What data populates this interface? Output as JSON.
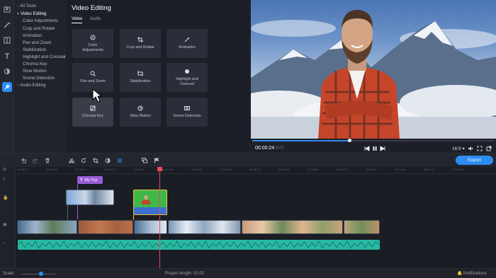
{
  "rail": {
    "icons": [
      "import-icon",
      "magic-wand-icon",
      "transitions-icon",
      "titles-icon",
      "filters-icon",
      "tools-icon"
    ]
  },
  "tree": {
    "items": [
      {
        "label": "All Tools",
        "top": true
      },
      {
        "label": "Video Editing",
        "top": true,
        "expanded": true
      },
      {
        "label": "Color Adjustments"
      },
      {
        "label": "Crop and Rotate"
      },
      {
        "label": "Animation"
      },
      {
        "label": "Pan and Zoom"
      },
      {
        "label": "Stabilization"
      },
      {
        "label": "Highlight and Conceal"
      },
      {
        "label": "Chroma Key"
      },
      {
        "label": "Slow Motion"
      },
      {
        "label": "Scene Detection"
      },
      {
        "label": "Audio Editing",
        "top": true
      }
    ]
  },
  "panel": {
    "title": "Video Editing",
    "tabs": [
      "Video",
      "Audio"
    ],
    "cards": [
      {
        "label": "Color\nAdjustments",
        "icon": "color-wheel-icon"
      },
      {
        "label": "Crop and Rotate",
        "icon": "crop-icon"
      },
      {
        "label": "Animation",
        "icon": "animation-icon"
      },
      {
        "label": "Pan and Zoom",
        "icon": "zoom-icon"
      },
      {
        "label": "Stabilization",
        "icon": "stabilization-icon"
      },
      {
        "label": "Highlight and\nConceal",
        "icon": "highlight-icon"
      },
      {
        "label": "Chroma Key",
        "icon": "chroma-key-icon"
      },
      {
        "label": "Slow Motion",
        "icon": "slow-motion-icon"
      },
      {
        "label": "Scene Detection",
        "icon": "scene-detection-icon"
      }
    ]
  },
  "player": {
    "time_current": "00:00:24",
    "time_frac": "870",
    "progress": 0.4,
    "ratio": "16:9 ▾"
  },
  "toolbar": {
    "export_label": "Export"
  },
  "timeline": {
    "ticks": [
      "00:00:00",
      "00:00:05",
      "00:00:10",
      "00:00:15",
      "00:00:20",
      "00:00:25",
      "00:00:30",
      "00:00:35",
      "00:00:40",
      "00:00:45",
      "00:00:50",
      "00:00:55",
      "00:01:00",
      "00:01:05",
      "00:01:10",
      "00:01:15"
    ],
    "title_clip": "My Trip"
  },
  "status": {
    "scale_label": "Scale:",
    "project_length": "Project length: 01:02",
    "notifications": "Notifications"
  },
  "colors": {
    "accent": "#2d8cf0",
    "playhead": "#e84a5f",
    "audio": "#28b9a2",
    "title_clip": "#9b5cd6"
  }
}
